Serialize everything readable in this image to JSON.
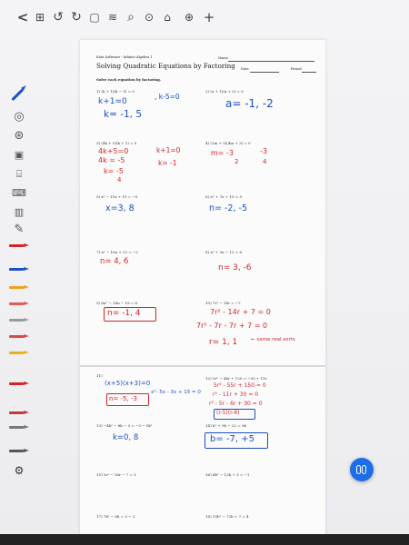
{
  "worksheet": {
    "publisher": "Kuta Software - Infinite Algebra 1",
    "title": "Solving Quadratic Equations by Factoring",
    "name_label": "Name",
    "date_label": "Date",
    "period_label": "Period",
    "instructions": "Solve each equation by factoring."
  },
  "problems": [
    {
      "label": "1)  (k + 1)(k − 5) = 0"
    },
    {
      "label": "2)  (a + 1)(a + 2) = 0"
    },
    {
      "label": "3)  (4k + 5)(k + 1) = 0"
    },
    {
      "label": "4)  (2m + 3)(4m + 3) = 0"
    },
    {
      "label": "5)  x² − 11x + 19 = −5"
    },
    {
      "label": "6)  n² + 7n + 15 = 5"
    },
    {
      "label": "7)  n² − 10n + 22 = −2"
    },
    {
      "label": "8)  n² + 3n − 12 = 6"
    },
    {
      "label": "9)  6n² − 18n − 18 = 6"
    },
    {
      "label": "10)  7r² − 14r = −7"
    },
    {
      "label": "11)"
    },
    {
      "label": "12)  5r² − 44r + 120 = −30 + 11r"
    },
    {
      "label": "13)  −4k² − 8k − 3 = −3 − 5k²"
    },
    {
      "label": "14)  b² + 9b − 22 = 9b"
    },
    {
      "label": "15)  5r² − 16r − 7 = 1"
    },
    {
      "label": "16)  4b² − 12b + 3 = −1"
    },
    {
      "label": "17)  7k² − 6k = 3 − 3"
    },
    {
      "label": "18)  10b² − 72b + 7 = 4"
    }
  ],
  "handwriting": {
    "p1_work": "k+1=0",
    "p1_work2": ", k-5=0",
    "p1_answer": "k= -1, 5",
    "p2_answer": "a= -1, -2",
    "p3_work1": "4k+5=0",
    "p3_work2": "4k = -5",
    "p3_work3": "k= -5",
    "p3_work3b": "4",
    "p3_work4": "k+1=0",
    "p3_work5": "k= -1",
    "p4_answer": "m= -3",
    "p4_answer_den": "2",
    "p4_answer2": "-3",
    "p4_answer2_den": "4",
    "p5_answer": "x=3, 8",
    "p6_answer": "n= -2, -5",
    "p7_answer": "n= 4, 6",
    "p8_answer": "n= 3, -6",
    "p9_answer": "n= -1, 4",
    "p10_work1": "7r² - 14r + 7 = 0",
    "p10_work2": "7r² - 7r - 7r + 7 = 0",
    "p10_answer": "r= 1, 1",
    "p10_note": "← same real sorts",
    "p11_work": "(x+5)(x+3)=0",
    "p11_work2": "x²- 5x - 3x + 15 = 0",
    "p11_answer": "n= -5, -3",
    "p12_work1": "5r² - 55r + 150 = 0",
    "p12_work2": "r² - 11r + 30 = 0",
    "p12_work3": "r² - 5r - 6r + 30 = 0",
    "p12_work4": "(r-5)(r-6)",
    "p13_answer": "k=0, 8",
    "p14_answer": "b= -7, +5"
  },
  "toolbar": {
    "back": "<",
    "grid": "⊞",
    "undo": "↺",
    "redo": "↻",
    "page": "▢",
    "layers": "≋",
    "search": "⌕",
    "lasso": "⊙",
    "lock": "⌂",
    "globe": "⊕",
    "add": "+"
  },
  "tools": {
    "pen_colors": [
      "#1b4fc2",
      "#d0262a",
      "#e05a5a",
      "#1b4fc2",
      "#f0a020",
      "#e8b020",
      "#d84a4a",
      "#d0262a",
      "#c83838",
      "#555555",
      "#e04040",
      "#888888",
      "#d0262a",
      "#555555"
    ]
  }
}
